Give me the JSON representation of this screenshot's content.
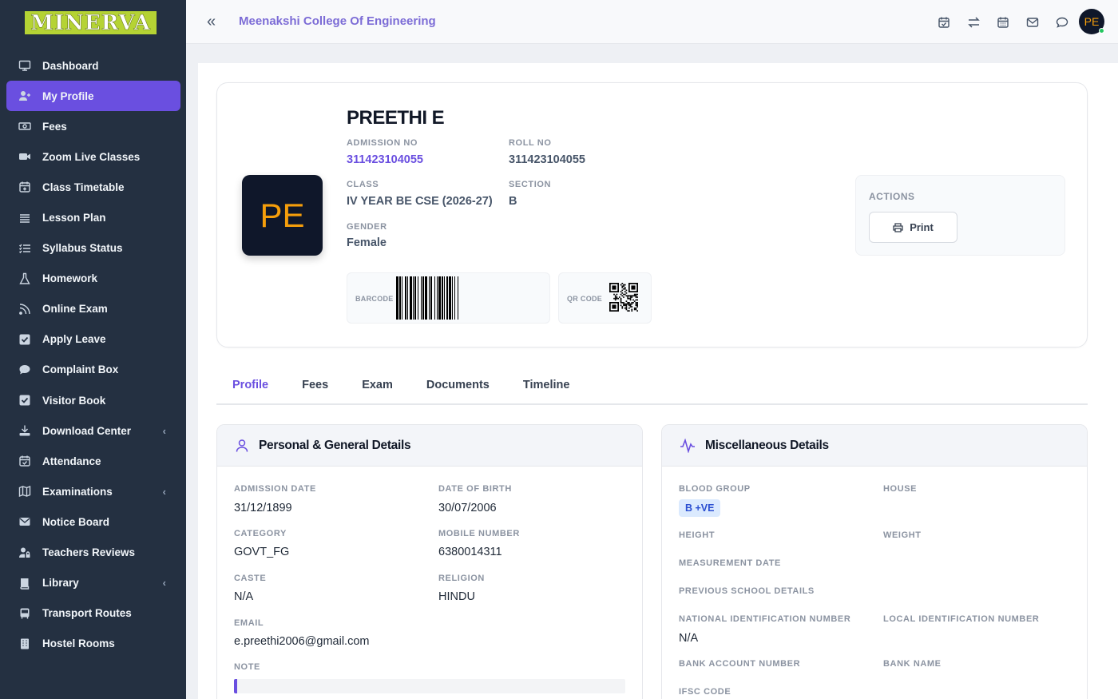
{
  "app": {
    "logo_text": "MINERVA",
    "college_name": "Meenakshi College Of Engineering",
    "user_initials": "PE",
    "accent": "#6a4fe0"
  },
  "sidebar": {
    "items": [
      {
        "label": "Dashboard",
        "icon": "monitor-icon"
      },
      {
        "label": "My Profile",
        "icon": "user-plus-icon",
        "active": true
      },
      {
        "label": "Fees",
        "icon": "money-icon"
      },
      {
        "label": "Zoom Live Classes",
        "icon": "video-icon"
      },
      {
        "label": "Class Timetable",
        "icon": "calendar-plus-icon"
      },
      {
        "label": "Lesson Plan",
        "icon": "list-icon"
      },
      {
        "label": "Syllabus Status",
        "icon": "checklist-icon"
      },
      {
        "label": "Homework",
        "icon": "flask-icon"
      },
      {
        "label": "Online Exam",
        "icon": "rss-icon"
      },
      {
        "label": "Apply Leave",
        "icon": "check-square-icon"
      },
      {
        "label": "Complaint Box",
        "icon": "comment-icon"
      },
      {
        "label": "Visitor Book",
        "icon": "check-square-icon"
      },
      {
        "label": "Download Center",
        "icon": "download-icon",
        "has_children": true
      },
      {
        "label": "Attendance",
        "icon": "calendar-check-icon"
      },
      {
        "label": "Examinations",
        "icon": "map-icon",
        "has_children": true
      },
      {
        "label": "Notice Board",
        "icon": "envelope-icon"
      },
      {
        "label": "Teachers Reviews",
        "icon": "user-lock-icon"
      },
      {
        "label": "Library",
        "icon": "book-icon",
        "has_children": true
      },
      {
        "label": "Transport Routes",
        "icon": "bus-icon"
      },
      {
        "label": "Hostel Rooms",
        "icon": "building-icon"
      }
    ]
  },
  "header": {
    "icons": [
      "calendar-check-icon",
      "swap-icon",
      "calendar-icon",
      "mail-icon",
      "chat-icon"
    ]
  },
  "profile": {
    "initials": "PE",
    "name": "PREETHI E",
    "admission_no_label": "ADMISSION NO",
    "admission_no": "311423104055",
    "roll_no_label": "ROLL NO",
    "roll_no": "311423104055",
    "class_label": "CLASS",
    "class": "IV YEAR BE CSE (2026-27)",
    "section_label": "SECTION",
    "section": "B",
    "gender_label": "GENDER",
    "gender": "Female",
    "barcode_label": "BARCODE",
    "qr_label": "QR CODE",
    "actions_label": "ACTIONS",
    "print_label": "Print"
  },
  "tabs": [
    "Profile",
    "Fees",
    "Exam",
    "Documents",
    "Timeline"
  ],
  "personal": {
    "title": "Personal & General Details",
    "admission_date_label": "ADMISSION DATE",
    "admission_date": "31/12/1899",
    "dob_label": "DATE OF BIRTH",
    "dob": "30/07/2006",
    "category_label": "CATEGORY",
    "category": "GOVT_FG",
    "mobile_label": "MOBILE NUMBER",
    "mobile": "6380014311",
    "caste_label": "CASTE",
    "caste": "N/A",
    "religion_label": "RELIGION",
    "religion": "HINDU",
    "email_label": "EMAIL",
    "email": "e.preethi2006@gmail.com",
    "note_label": "NOTE"
  },
  "misc": {
    "title": "Miscellaneous Details",
    "blood_group_label": "BLOOD GROUP",
    "blood_group": "B +VE",
    "house_label": "HOUSE",
    "height_label": "HEIGHT",
    "weight_label": "WEIGHT",
    "measurement_date_label": "MEASUREMENT DATE",
    "previous_school_label": "PREVIOUS SCHOOL DETAILS",
    "national_id_label": "NATIONAL IDENTIFICATION NUMBER",
    "national_id": "N/A",
    "local_id_label": "LOCAL IDENTIFICATION NUMBER",
    "bank_account_label": "BANK ACCOUNT NUMBER",
    "bank_name_label": "BANK NAME",
    "ifsc_label": "IFSC CODE"
  }
}
